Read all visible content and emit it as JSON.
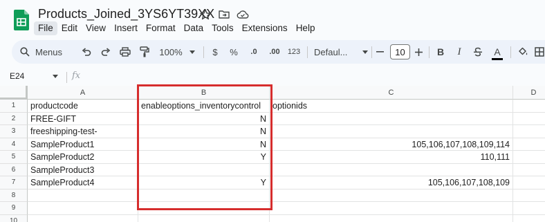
{
  "app": {
    "title": "Products_Joined_3YS6YT39XX",
    "menu": [
      "File",
      "Edit",
      "View",
      "Insert",
      "Format",
      "Data",
      "Tools",
      "Extensions",
      "Help"
    ],
    "active_menu": "File"
  },
  "toolbar": {
    "search_label": "Menus",
    "zoom": "100%",
    "currency": "$",
    "percent": "%",
    "decrease_decimals": ".0",
    "increase_decimals": ".00",
    "number_format": "123",
    "font": "Defaul...",
    "font_size": "10",
    "bold": "B",
    "italic": "I",
    "text_color": "A"
  },
  "formula_bar": {
    "cell_ref": "E24",
    "fx": "fx"
  },
  "sheet": {
    "columns": [
      "A",
      "B",
      "C",
      "D"
    ],
    "rows": [
      {
        "n": "1",
        "a": "productcode",
        "b": "enableoptions_inventorycontrol",
        "c": "optionids"
      },
      {
        "n": "2",
        "a": "FREE-GIFT",
        "b": "N",
        "c": ""
      },
      {
        "n": "3",
        "a": "freeshipping-test-",
        "b": "N",
        "c": ""
      },
      {
        "n": "4",
        "a": "SampleProduct1",
        "b": "N",
        "c": "105,106,107,108,109,114"
      },
      {
        "n": "5",
        "a": "SampleProduct2",
        "b": "Y",
        "c": "110,111"
      },
      {
        "n": "6",
        "a": "SampleProduct3",
        "b": "",
        "c": ""
      },
      {
        "n": "7",
        "a": "SampleProduct4",
        "b": "Y",
        "c": "105,106,107,108,109"
      },
      {
        "n": "8",
        "a": "",
        "b": "",
        "c": ""
      },
      {
        "n": "9",
        "a": "",
        "b": "",
        "c": ""
      },
      {
        "n": "10",
        "a": "",
        "b": "",
        "c": ""
      }
    ]
  },
  "colors": {
    "highlight": "#d62d2d",
    "sheets_green": "#0f9d58",
    "toolbar_bg": "#edf2fa"
  }
}
